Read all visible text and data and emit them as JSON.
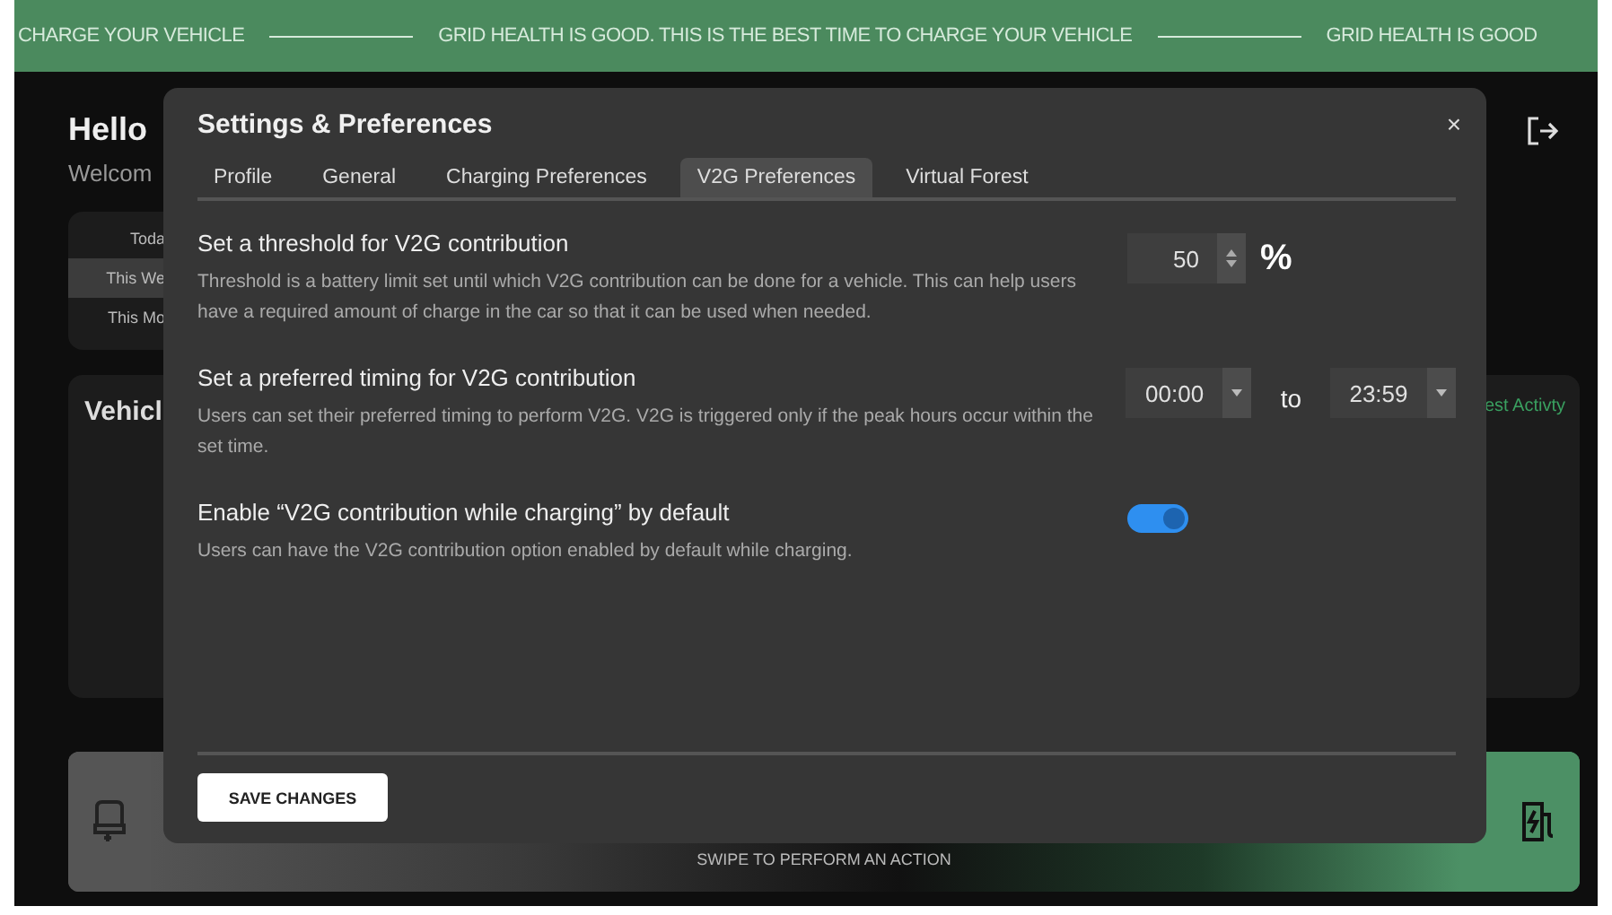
{
  "banner": {
    "messages": [
      "CHARGE YOUR VEHICLE",
      "GRID HEALTH IS GOOD. THIS IS THE BEST TIME TO CHARGE YOUR VEHICLE",
      "GRID HEALTH IS GOOD"
    ]
  },
  "header": {
    "greeting": "Hello",
    "subtitle": "Welcom"
  },
  "period_tabs": [
    {
      "label": "Toda",
      "selected": false
    },
    {
      "label": "This We",
      "selected": true
    },
    {
      "label": "This Mo",
      "selected": false
    }
  ],
  "vehicle_card": {
    "title": "Vehicl",
    "link": "est Activty"
  },
  "swipe_bar": {
    "hint": "SWIPE TO PERFORM AN ACTION"
  },
  "dialog": {
    "title": "Settings & Preferences",
    "close": "×",
    "tabs": [
      {
        "label": "Profile",
        "selected": false
      },
      {
        "label": "General",
        "selected": false
      },
      {
        "label": "Charging Preferences",
        "selected": false
      },
      {
        "label": "V2G Preferences",
        "selected": true
      },
      {
        "label": "Virtual Forest",
        "selected": false
      }
    ],
    "settings": [
      {
        "kind": "number",
        "title": "Set a threshold for V2G contribution",
        "description": "Threshold is a battery limit set until which V2G contribution can be done for a vehicle. This can help  users have a required amount of charge  in the car so that it can be used when needed.",
        "value": "50",
        "unit": "%"
      },
      {
        "kind": "time-range",
        "title": "Set a preferred timing for V2G contribution",
        "description": "Users can set their preferred timing to perform V2G. V2G is triggered only if the peak hours occur within the set time.",
        "from": "00:00",
        "separator": "to",
        "to": "23:59"
      },
      {
        "kind": "toggle",
        "title": "Enable “V2G contribution while charging” by default",
        "description": "Users can  have the V2G contribution option enabled by default while charging.",
        "on": true
      }
    ],
    "save_button": "SAVE CHANGES"
  }
}
